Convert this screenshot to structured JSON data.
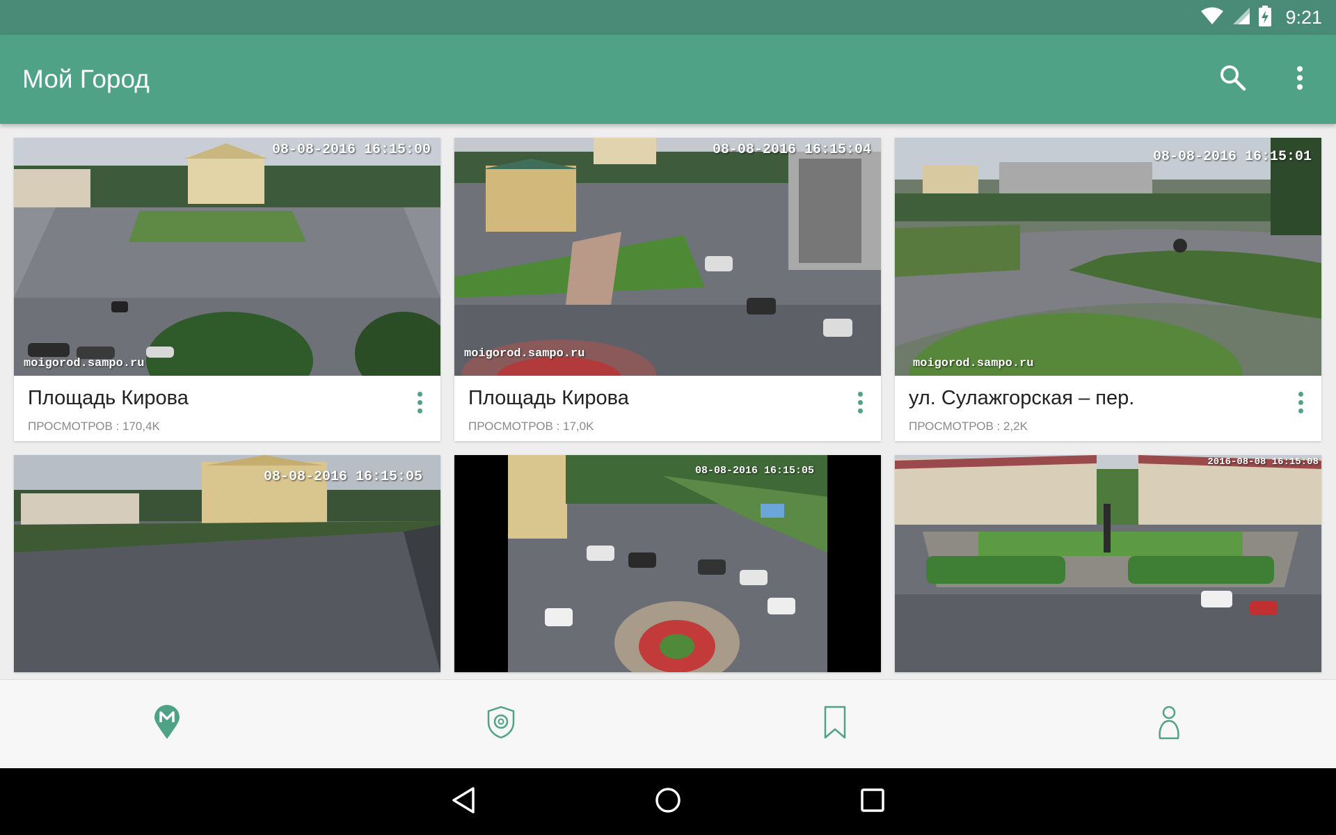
{
  "status_bar": {
    "time": "9:21",
    "icons": [
      "wifi-icon",
      "signal-icon",
      "battery-charging-icon"
    ]
  },
  "app_bar": {
    "title": "Мой Город",
    "actions": [
      "search-icon",
      "more-vert-icon"
    ]
  },
  "cameras": [
    {
      "title": "Площадь Кирова",
      "views_label": "ПРОСМОТРОВ :",
      "views_count": "170,4K",
      "timestamp": "08-08-2016 16:15:00",
      "watermark": "moigorod.sampo.ru"
    },
    {
      "title": "Площадь Кирова",
      "views_label": "ПРОСМОТРОВ :",
      "views_count": "17,0K",
      "timestamp": "08-08-2016 16:15:04",
      "watermark": "moigorod.sampo.ru"
    },
    {
      "title": "ул. Сулажгорская – пер.",
      "views_label": "ПРОСМОТРОВ :",
      "views_count": "2,2K",
      "timestamp": "08-08-2016 16:15:01",
      "watermark": "moigorod.sampo.ru"
    },
    {
      "timestamp": "08-08-2016 16:15:05"
    },
    {
      "timestamp": "08-08-2016 16:15:05"
    },
    {
      "timestamp": "2016-08-08 16:15:08"
    }
  ],
  "bottom_nav": {
    "items": [
      "map-pin-icon",
      "camera-shield-icon",
      "bookmark-icon",
      "profile-icon"
    ],
    "active_index": 0,
    "accent_color": "#4fa286"
  },
  "system_nav": {
    "items": [
      "back-icon",
      "home-icon",
      "recents-icon"
    ]
  },
  "colors": {
    "status_bar": "#4a8b78",
    "app_bar": "#4fa286",
    "accent": "#4fa286",
    "background": "#eeeeee"
  }
}
